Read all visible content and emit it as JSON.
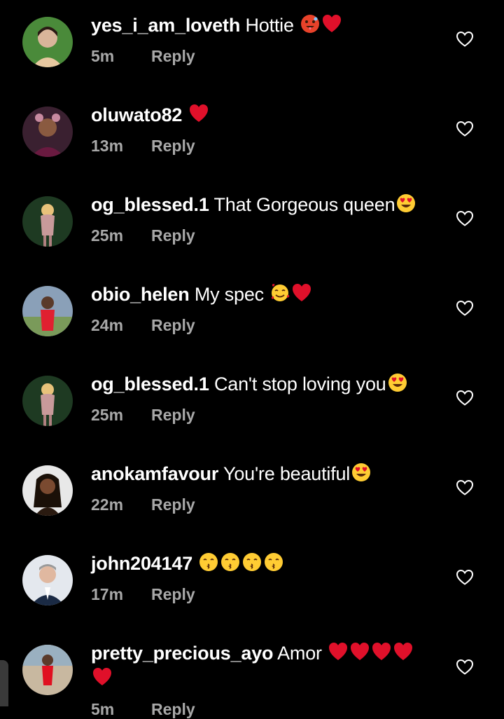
{
  "comments": [
    {
      "username": "yes_i_am_loveth",
      "text": "Hottie",
      "time": "5m",
      "reply": "Reply",
      "emojis": [
        "hot-face",
        "red-heart"
      ]
    },
    {
      "username": "oluwato82",
      "text": "",
      "time": "13m",
      "reply": "Reply",
      "emojis": [
        "red-heart"
      ]
    },
    {
      "username": "og_blessed.1",
      "text": "That Gorgeous queen",
      "time": "25m",
      "reply": "Reply",
      "emojis": [
        "heart-eyes"
      ]
    },
    {
      "username": "obio_helen",
      "text": "My spec",
      "time": "24m",
      "reply": "Reply",
      "emojis": [
        "smiling-hearts",
        "red-heart"
      ]
    },
    {
      "username": "og_blessed.1",
      "text": "Can't stop loving you",
      "time": "25m",
      "reply": "Reply",
      "emojis": [
        "heart-eyes"
      ]
    },
    {
      "username": "anokamfavour",
      "text": "You're beautiful",
      "time": "22m",
      "reply": "Reply",
      "emojis": [
        "heart-eyes"
      ]
    },
    {
      "username": "john204147",
      "text": "",
      "time": "17m",
      "reply": "Reply",
      "emojis": [
        "kissing-face",
        "kissing-face",
        "kissing-face",
        "kissing-face"
      ]
    },
    {
      "username": "pretty_precious_ayo",
      "text": "Amor",
      "time": "5m",
      "reply": "Reply",
      "emojis": [
        "red-heart",
        "red-heart",
        "red-heart",
        "red-heart",
        "red-heart"
      ]
    }
  ],
  "colors": {
    "background": "#000000",
    "text": "#ffffff",
    "meta": "#a8a8a8",
    "heart": "#e0102a"
  },
  "icons": {
    "like": "heart-outline-icon"
  }
}
